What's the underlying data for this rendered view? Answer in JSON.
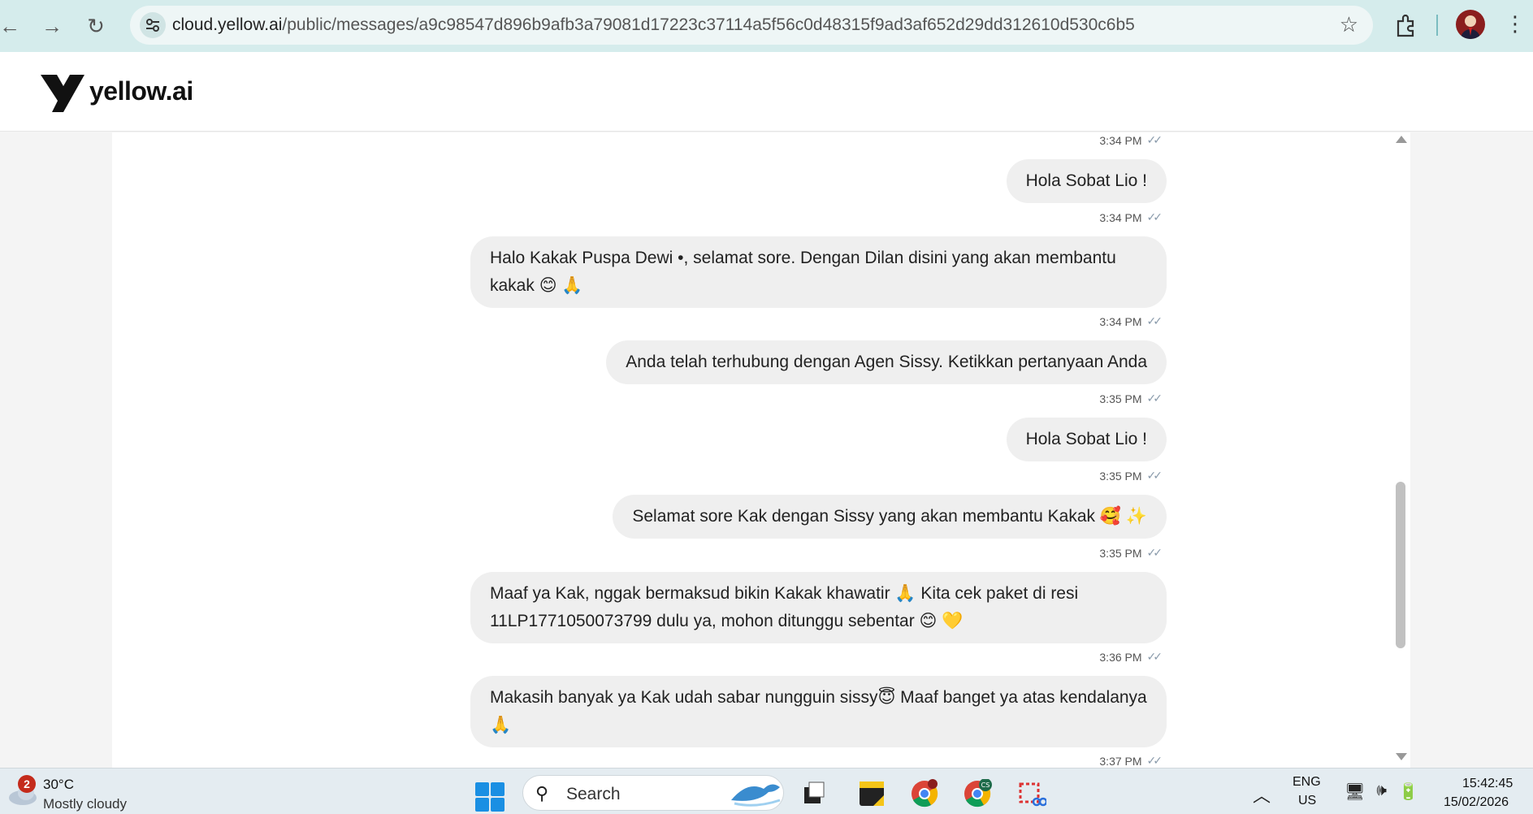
{
  "browser": {
    "url_host": "cloud.yellow.ai",
    "url_path": "/public/messages/a9c98547d896b9afb3a79081d17223c37114a5f56c0d48315f9ad3af652d29dd312610d530c6b5"
  },
  "app": {
    "brand": "yellow.ai"
  },
  "chat": {
    "messages": [
      {
        "time": "3:34 PM",
        "text": ""
      },
      {
        "time": "3:34 PM",
        "text": "Hola Sobat Lio !"
      },
      {
        "time": "3:34 PM",
        "text": "Halo Kakak Puspa Dewi •, selamat sore. Dengan Dilan disini yang akan membantu kakak 😊 🙏"
      },
      {
        "time": "3:35 PM",
        "text": "Anda telah terhubung dengan Agen Sissy. Ketikkan pertanyaan Anda"
      },
      {
        "time": "3:35 PM",
        "text": "Hola Sobat Lio !"
      },
      {
        "time": "3:35 PM",
        "text": "Selamat sore Kak dengan Sissy yang akan membantu Kakak 🥰 ✨"
      },
      {
        "time": "3:36 PM",
        "text": "Maaf ya Kak, nggak bermaksud bikin Kakak khawatir 🙏 Kita cek paket di resi 11LP1771050073799 dulu ya, mohon ditunggu sebentar 😊 💛"
      },
      {
        "time": "3:37 PM",
        "text": "Makasih banyak ya Kak udah sabar nungguin sissy😇 Maaf banget ya atas kendalanya 🙏"
      }
    ]
  },
  "taskbar": {
    "weather_badge": "2",
    "weather_temp": "30°C",
    "weather_desc": "Mostly cloudy",
    "search_label": "Search",
    "lang_line1": "ENG",
    "lang_line2": "US",
    "time": "15:42:45",
    "date": "15/02/2026"
  },
  "icons": [
    "back-icon",
    "forward-icon",
    "reload-icon",
    "site-settings-icon",
    "star-icon",
    "extensions-icon",
    "profile-avatar",
    "menu-icon",
    "user-avatar",
    "double-check-icon",
    "windows-start-icon",
    "search-icon",
    "task-view-icon",
    "sticky-notes-icon",
    "chrome-icon",
    "chrome-cs-icon",
    "snipping-tool-icon",
    "wifi-icon",
    "volume-icon",
    "battery-icon"
  ],
  "colors": {
    "browser_bar": "#d5ecec",
    "bubble": "#efefef",
    "accent": "#1a8fe3"
  }
}
